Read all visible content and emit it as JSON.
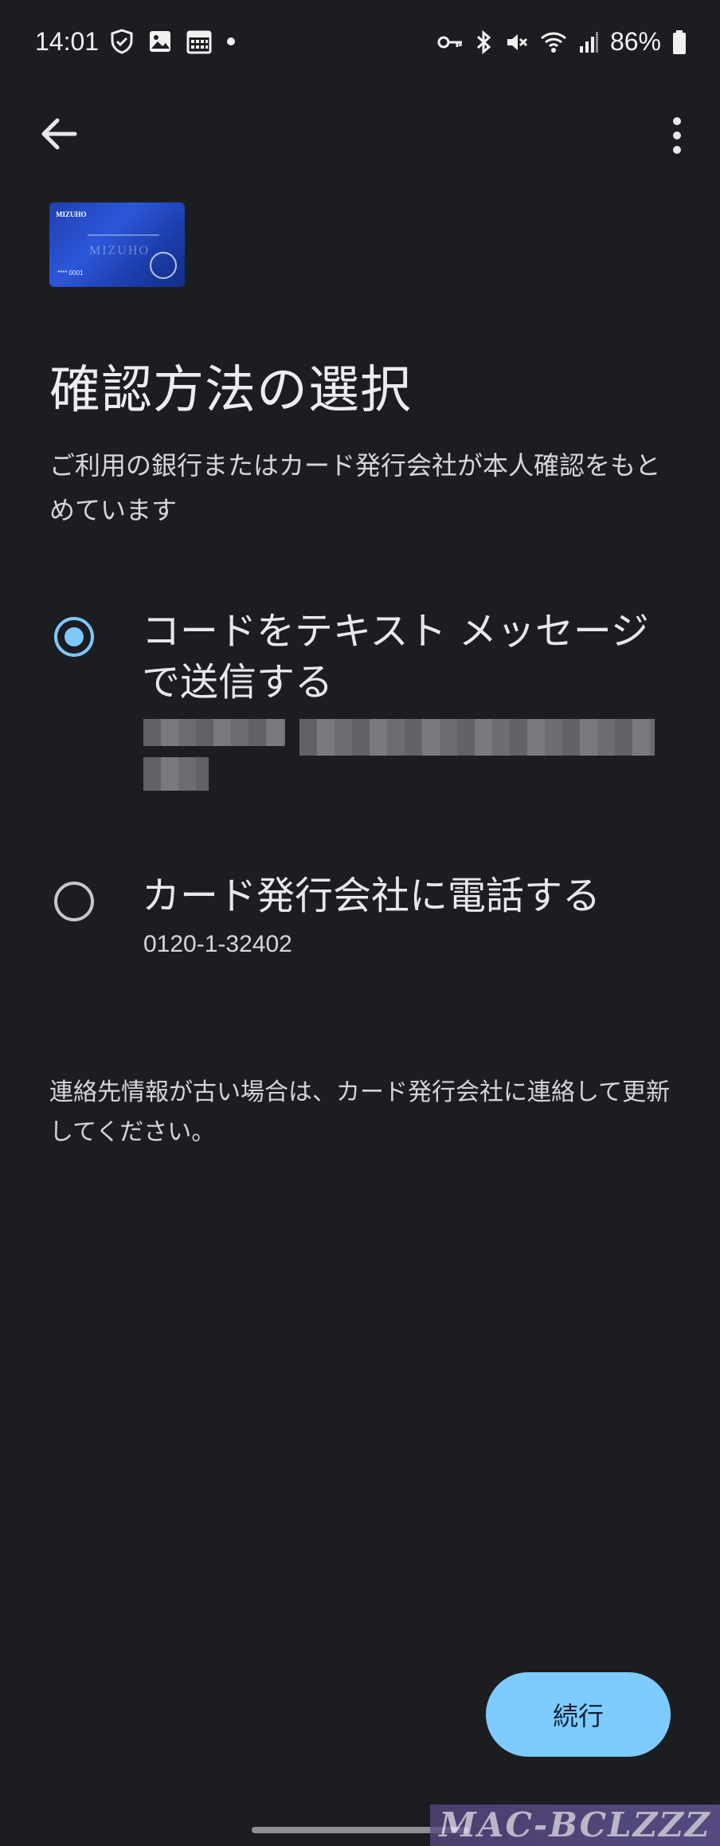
{
  "status_bar": {
    "time": "14:01",
    "battery_percent": "86%",
    "left_icons": [
      "shield-check-icon",
      "image-icon",
      "calendar-icon",
      "dot-icon"
    ],
    "right_icons": [
      "key-icon",
      "bluetooth-icon",
      "mute-icon",
      "wifi-icon",
      "signal-icon",
      "battery-icon"
    ]
  },
  "toolbar": {
    "back_icon": "arrow-back-icon",
    "more_icon": "more-vert-icon"
  },
  "card": {
    "brand": "MIZUHO",
    "watermark": "MIZUHO",
    "number": "**** 0001"
  },
  "header": {
    "title": "確認方法の選択",
    "description": "ご利用の銀行またはカード発行会社が本人確認をもとめています"
  },
  "options": [
    {
      "label": "コードをテキスト メッセージで送信する",
      "selected": true
    },
    {
      "label": "カード発行会社に電話する",
      "detail": "0120-1-32402",
      "selected": false
    }
  ],
  "note": "連絡先情報が古い場合は、カード発行会社に連絡して更新してください。",
  "actions": {
    "continue_label": "続行"
  },
  "watermark": {
    "text": "MAC-BCLZZZ"
  },
  "colors": {
    "background": "#1b1d21",
    "accent": "#7ecbff",
    "text": "#e3e3e6"
  }
}
